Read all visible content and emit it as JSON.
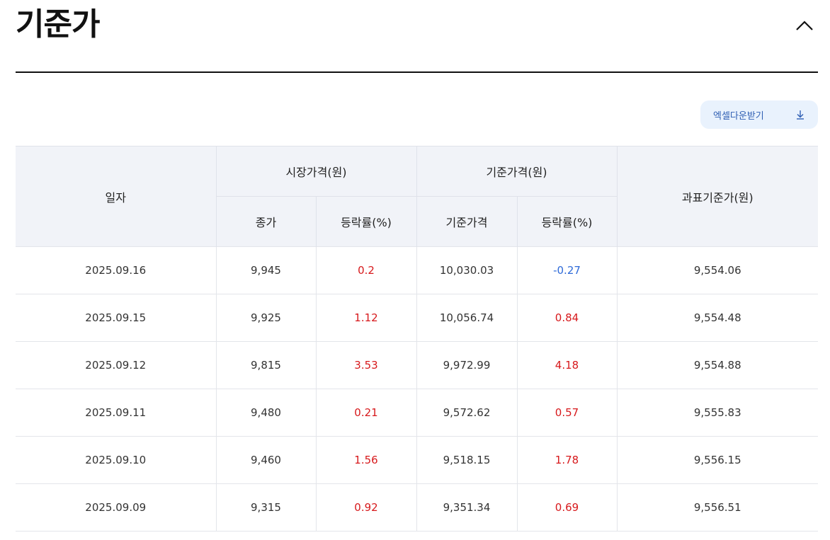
{
  "header": {
    "title": "기준가"
  },
  "toolbar": {
    "excel_label": "엑셀다운받기"
  },
  "table": {
    "headers": {
      "date": "일자",
      "market_group": "시장가격(원)",
      "nav_group": "기준가격(원)",
      "tax_nav": "과표기준가(원)",
      "close": "종가",
      "market_change": "등락률(%)",
      "nav": "기준가격",
      "nav_change": "등락률(%)"
    },
    "rows": [
      {
        "date": "2025.09.16",
        "close": "9,945",
        "market_change": "0.2",
        "market_dir": "up",
        "nav": "10,030.03",
        "nav_change": "-0.27",
        "nav_dir": "down",
        "tax_nav": "9,554.06"
      },
      {
        "date": "2025.09.15",
        "close": "9,925",
        "market_change": "1.12",
        "market_dir": "up",
        "nav": "10,056.74",
        "nav_change": "0.84",
        "nav_dir": "up",
        "tax_nav": "9,554.48"
      },
      {
        "date": "2025.09.12",
        "close": "9,815",
        "market_change": "3.53",
        "market_dir": "up",
        "nav": "9,972.99",
        "nav_change": "4.18",
        "nav_dir": "up",
        "tax_nav": "9,554.88"
      },
      {
        "date": "2025.09.11",
        "close": "9,480",
        "market_change": "0.21",
        "market_dir": "up",
        "nav": "9,572.62",
        "nav_change": "0.57",
        "nav_dir": "up",
        "tax_nav": "9,555.83"
      },
      {
        "date": "2025.09.10",
        "close": "9,460",
        "market_change": "1.56",
        "market_dir": "up",
        "nav": "9,518.15",
        "nav_change": "1.78",
        "nav_dir": "up",
        "tax_nav": "9,556.15"
      },
      {
        "date": "2025.09.09",
        "close": "9,315",
        "market_change": "0.92",
        "market_dir": "up",
        "nav": "9,351.34",
        "nav_change": "0.69",
        "nav_dir": "up",
        "tax_nav": "9,556.51"
      }
    ]
  },
  "colors": {
    "up": "#d7191c",
    "down": "#2f6bd8",
    "header_bg": "#f1f3f8",
    "excel_bg": "#e9f2fd"
  },
  "icons": {
    "collapse": "chevron-up-icon",
    "download": "download-icon"
  }
}
